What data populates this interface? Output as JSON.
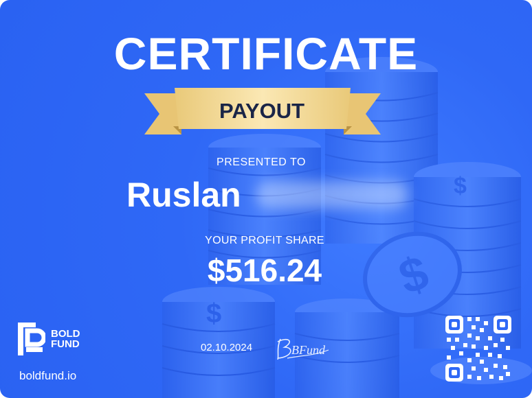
{
  "certificate": {
    "title": "CERTIFICATE",
    "ribbon_label": "PAYOUT",
    "presented_label": "PRESENTED TO",
    "recipient_first_name": "Ruslan",
    "profit_label": "YOUR PROFIT SHARE",
    "amount": "$516.24",
    "date": "02.10.2024",
    "signature_text": "BFund"
  },
  "brand": {
    "logo_line1": "BOLD",
    "logo_line2": "FUND",
    "website": "boldfund.io"
  },
  "colors": {
    "background": "#2f68f6",
    "ribbon": "#f1d48a",
    "ribbon_text": "#1a2547",
    "text": "#ffffff"
  }
}
